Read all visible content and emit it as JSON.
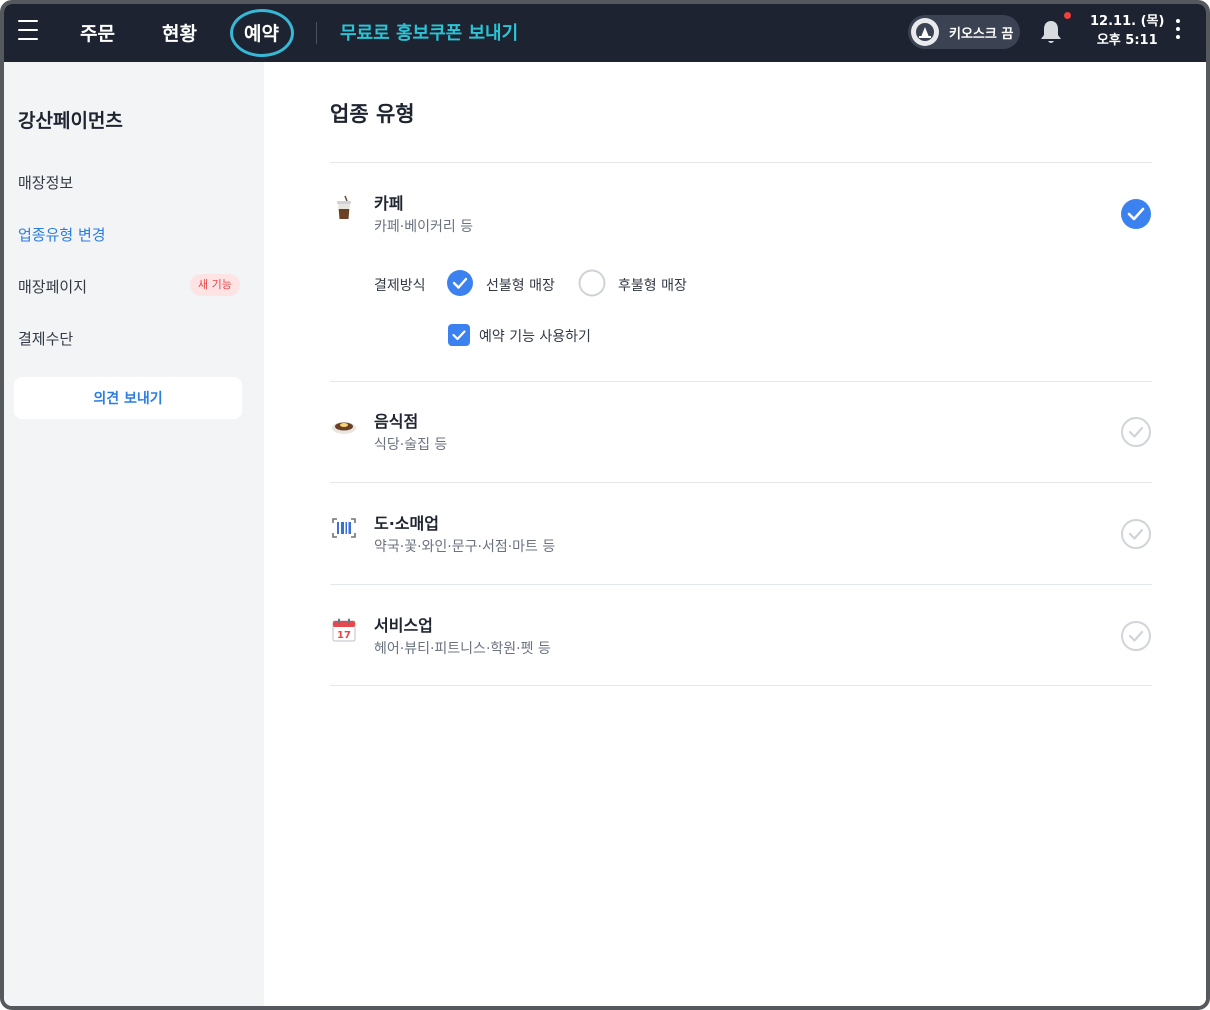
{
  "topbar": {
    "nav": [
      "주문",
      "현황",
      "예약"
    ],
    "promo": "무료로 홍보쿠폰 보내기",
    "kiosk_label": "키오스크 끔",
    "date": "12.11. (목)",
    "time": "오후 5:11"
  },
  "sidebar": {
    "store_name": "강산페이먼츠",
    "items": [
      {
        "label": "매장정보"
      },
      {
        "label": "업종유형 변경",
        "active": true
      },
      {
        "label": "매장페이지",
        "badge": "새 기능"
      },
      {
        "label": "결제수단"
      }
    ],
    "feedback_button": "의견 보내기"
  },
  "main": {
    "title": "업종 유형",
    "categories": [
      {
        "name": "카페",
        "desc": "카페·베이커리 등",
        "icon": "coffee-icon",
        "selected": true
      },
      {
        "name": "음식점",
        "desc": "식당·술집 등",
        "icon": "dish-icon",
        "selected": false
      },
      {
        "name": "도·소매업",
        "desc": "약국·꽃·와인·문구·서점·마트 등",
        "icon": "barcode-icon",
        "selected": false
      },
      {
        "name": "서비스업",
        "desc": "헤어·뷰티·피트니스·학원·펫 등",
        "icon": "calendar-icon",
        "selected": false
      }
    ],
    "payment": {
      "label": "결제방식",
      "options": [
        "선불형 매장",
        "후불형 매장"
      ],
      "selected": "선불형 매장"
    },
    "reservation_checkbox": {
      "label": "예약 기능 사용하기",
      "checked": true
    },
    "calendar_day": "17"
  },
  "colors": {
    "topbar_bg": "#1d2330",
    "accent_blue": "#3b82f0",
    "promo_cyan": "#2bc4d6",
    "highlight_circle": "#36b8d6"
  }
}
